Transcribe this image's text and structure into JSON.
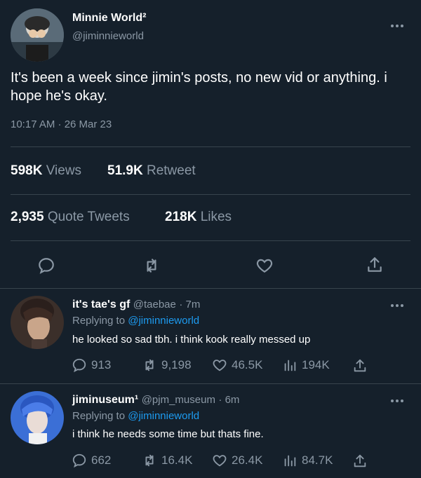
{
  "main_tweet": {
    "display_name": "Minnie World²",
    "handle": "@jiminnieworld",
    "text": "It's been a week since jimin's posts, no new vid or anything. i hope he's okay.",
    "time": "10:17 AM · 26 Mar 23",
    "views_count": "598K",
    "views_label": "Views",
    "retweet_count": "51.9K",
    "retweet_label": "Retweet",
    "quote_count": "2,935",
    "quote_label": "Quote Tweets",
    "likes_count": "218K",
    "likes_label": "Likes",
    "icons": [
      "reply-icon",
      "retweet-icon",
      "like-icon",
      "share-icon"
    ]
  },
  "replies": [
    {
      "display_name": "it's tae's gf",
      "handle": "@taebae",
      "time": "· 7m",
      "replying_to_label": "Replying to",
      "replying_to_handle": "@jiminnieworld",
      "text": "he looked so sad tbh. i think kook really messed up",
      "reply_count": "913",
      "retweet_count": "9,198",
      "like_count": "46.5K",
      "view_count": "194K"
    },
    {
      "display_name": "jiminuseum¹",
      "handle": "@pjm_museum",
      "time": "· 6m",
      "replying_to_label": "Replying to",
      "replying_to_handle": "@jiminnieworld",
      "text": "i think he needs some time but thats fine.",
      "reply_count": "662",
      "retweet_count": "16.4K",
      "like_count": "26.4K",
      "view_count": "84.7K"
    }
  ],
  "colors": {
    "background": "#15202b",
    "muted": "#8b98a5",
    "link": "#1d9bf0",
    "divider": "#38444d"
  }
}
